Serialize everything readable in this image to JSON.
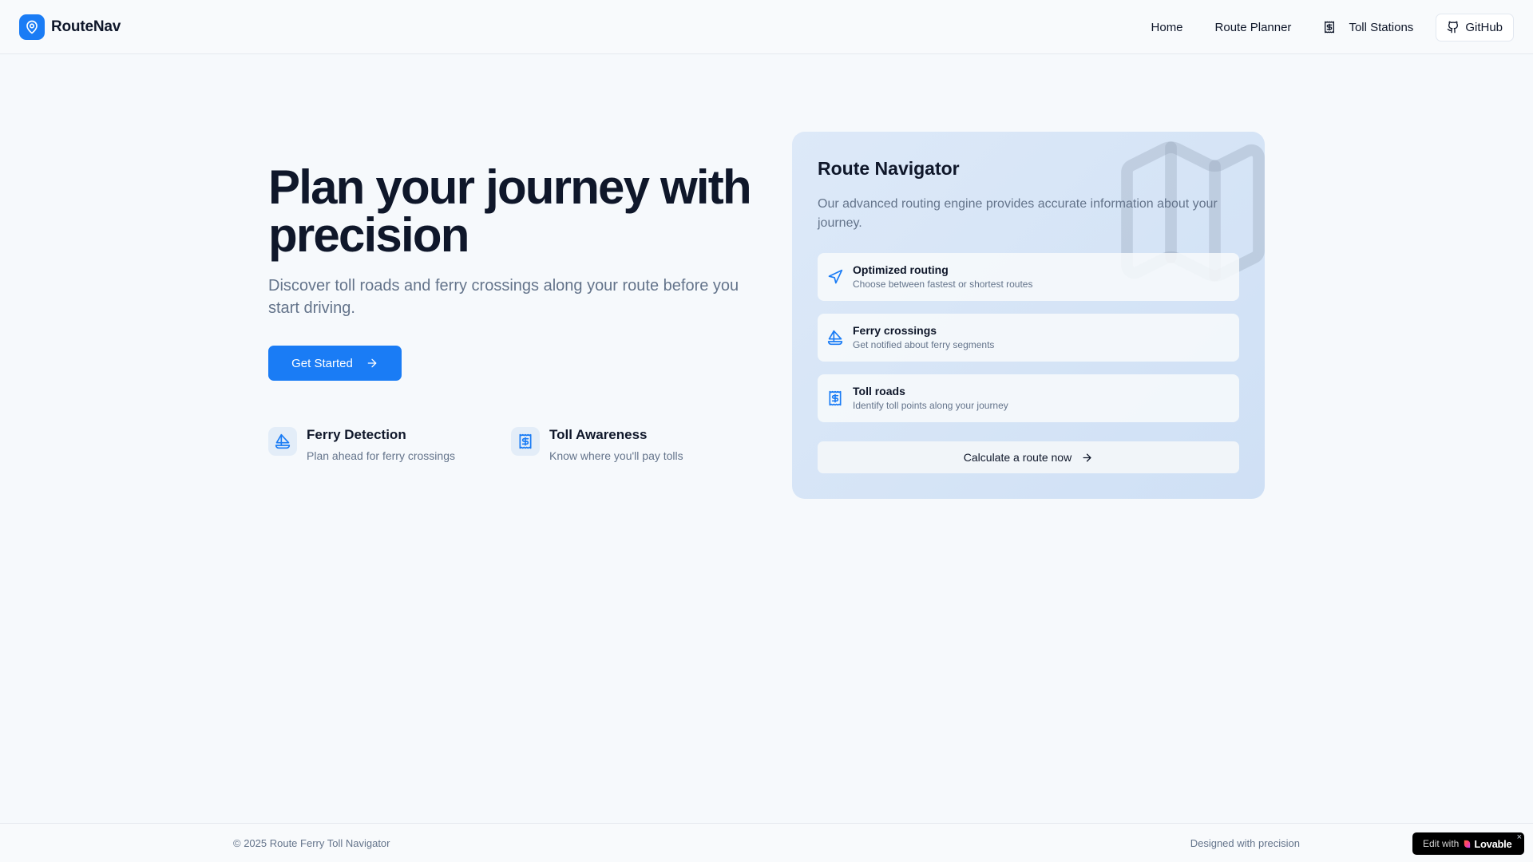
{
  "header": {
    "brand_name": "RouteNav",
    "nav": {
      "home": "Home",
      "route_planner": "Route Planner",
      "toll_stations": "Toll Stations",
      "github": "GitHub"
    }
  },
  "hero": {
    "title": "Plan your journey with precision",
    "subtitle": "Discover toll roads and ferry crossings along your route before you start driving.",
    "cta_label": "Get Started",
    "mini_features": [
      {
        "title": "Ferry Detection",
        "desc": "Plan ahead for ferry crossings",
        "icon": "sailboat-icon"
      },
      {
        "title": "Toll Awareness",
        "desc": "Know where you'll pay tolls",
        "icon": "toll-receipt-icon"
      }
    ]
  },
  "card": {
    "title": "Route Navigator",
    "description": "Our advanced routing engine provides accurate information about your journey.",
    "features": [
      {
        "title": "Optimized routing",
        "desc": "Choose between fastest or shortest routes",
        "icon": "navigation-icon"
      },
      {
        "title": "Ferry crossings",
        "desc": "Get notified about ferry segments",
        "icon": "sailboat-icon"
      },
      {
        "title": "Toll roads",
        "desc": "Identify toll points along your journey",
        "icon": "toll-receipt-icon"
      }
    ],
    "calc_label": "Calculate a route now"
  },
  "footer": {
    "copyright": "© 2025 Route Ferry Toll Navigator",
    "designed": "Designed with precision",
    "lovable_edit": "Edit with",
    "lovable_brand": "Lovable",
    "lovable_close": "×"
  },
  "colors": {
    "accent": "#1a7cf5",
    "background": "#f6f9fc",
    "text": "#0f172a",
    "muted": "#64748b"
  }
}
